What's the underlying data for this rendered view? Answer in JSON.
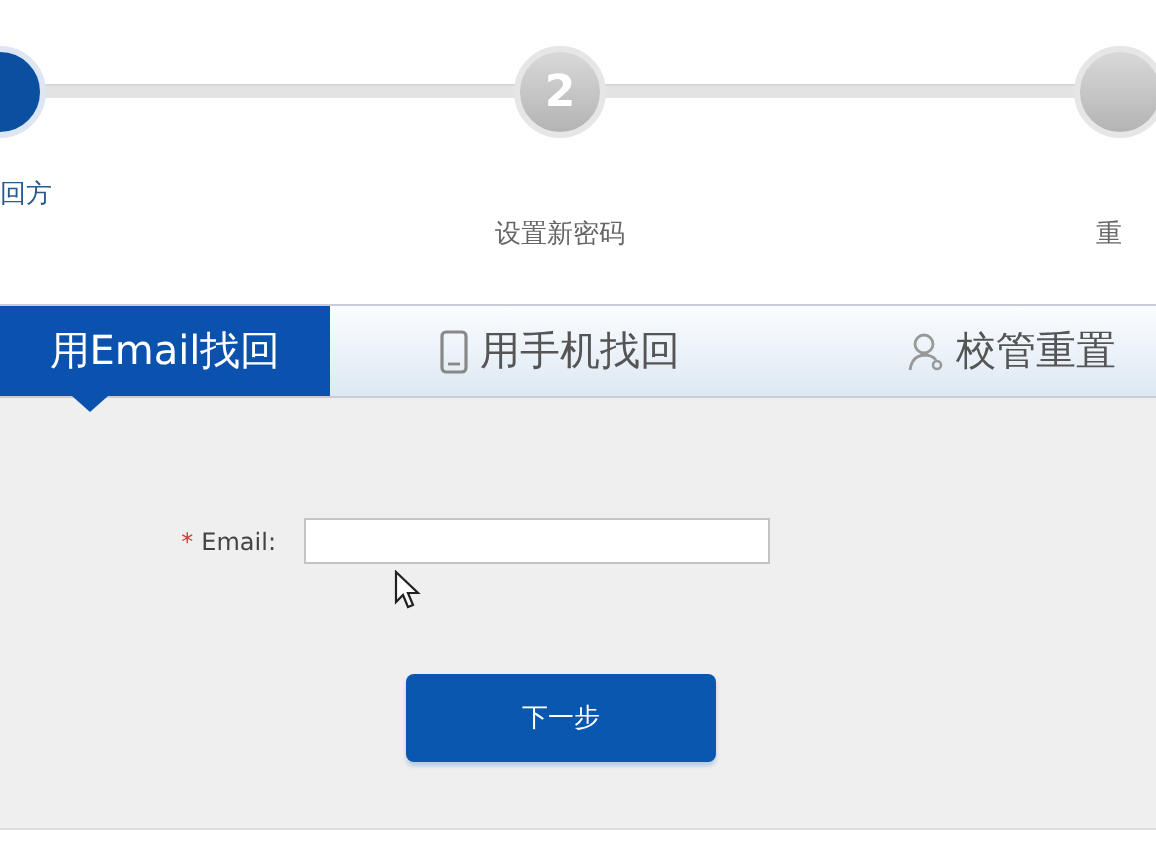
{
  "steps": [
    {
      "label": "回方",
      "selected": true
    },
    {
      "number": "2",
      "label": "设置新密码",
      "selected": false
    },
    {
      "label": "重",
      "selected": false
    }
  ],
  "tabs": [
    {
      "kind": "plain",
      "label": "用Email找回",
      "selected": true
    },
    {
      "kind": "phone",
      "label": "用手机找回",
      "selected": false
    },
    {
      "kind": "user",
      "label": "校管重置",
      "selected": false
    }
  ],
  "form": {
    "field_label": "Email:",
    "required_mark": "*",
    "button": "下一步"
  }
}
